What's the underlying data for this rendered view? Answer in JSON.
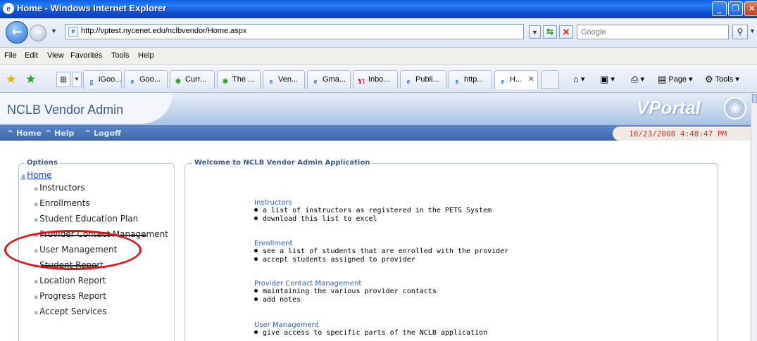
{
  "window": {
    "title": "Home - Windows Internet Explorer"
  },
  "address_bar": {
    "url": "http://vptest.nycenet.edu/nclbvendor/Home.aspx",
    "search_placeholder": "Google"
  },
  "menu": [
    "File",
    "Edit",
    "View",
    "Favorites",
    "Tools",
    "Help"
  ],
  "tabs": [
    {
      "label": "iGoo...",
      "icon": "google-icon"
    },
    {
      "label": "Goo...",
      "icon": "ie-page-icon"
    },
    {
      "label": "Curr...",
      "icon": "spark-icon"
    },
    {
      "label": "The ...",
      "icon": "spark-icon"
    },
    {
      "label": "Ven...",
      "icon": "ie-page-icon"
    },
    {
      "label": "Gma...",
      "icon": "ie-page-icon"
    },
    {
      "label": "Inbo...",
      "icon": "yahoo-icon"
    },
    {
      "label": "Publi...",
      "icon": "ie-page-icon"
    },
    {
      "label": "http...",
      "icon": "ie-page-icon"
    },
    {
      "label": "H...",
      "icon": "ie-page-icon",
      "active": true
    }
  ],
  "command_bar": {
    "page_label": "Page",
    "tools_label": "Tools"
  },
  "app": {
    "name": "NCLB Vendor Admin",
    "brand": "VPortal",
    "nav": [
      "^ Home",
      "^ Help",
      "^ Logoff"
    ],
    "datetime": "10/23/2008 4:48:47 PM"
  },
  "options": {
    "legend": "Options",
    "home": "Home",
    "items": [
      "Instructors",
      "Enrollments",
      "Student Education Plan",
      "Provider Contact Management",
      "User Management",
      "Student Report",
      "Location Report",
      "Progress Report",
      "Accept Services"
    ]
  },
  "welcome": {
    "legend": "Welcome to NCLB Vendor Admin Application",
    "sections": [
      {
        "title": "Instructors",
        "bullets": [
          "a list of instructors as registered in the PETS System",
          "download this list to excel"
        ]
      },
      {
        "title": "Enrollment",
        "bullets": [
          "see a list of students that are enrolled with the provider",
          "accept students assigned to provider"
        ]
      },
      {
        "title": "Provider Contact Management",
        "bullets": [
          "maintaining the various provider contacts",
          "add notes"
        ]
      },
      {
        "title": "User Management",
        "bullets": [
          "give access to specific parts of the NCLB application"
        ]
      }
    ]
  },
  "colors": {
    "annotation_circle": "#e01414",
    "link": "#1a3ad1",
    "section_title": "#2b5fb8",
    "date": "#c0392b"
  }
}
